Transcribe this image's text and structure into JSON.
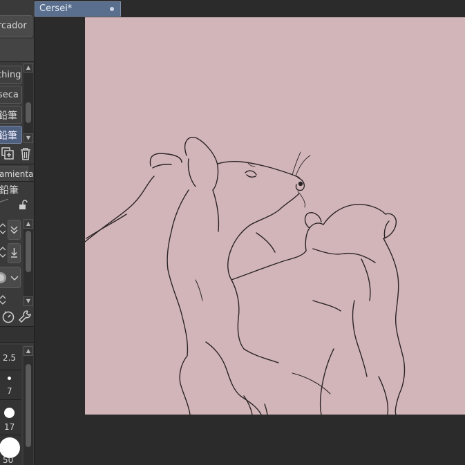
{
  "document_tab": {
    "title": "Cersei*"
  },
  "left_panel": {
    "top_button": "rcador",
    "subtool_list": [
      {
        "label": "thing",
        "selected": false
      },
      {
        "label": "seca",
        "selected": false
      },
      {
        "label": "鉛筆",
        "selected": false
      },
      {
        "label": "鉛筆",
        "selected": true
      }
    ],
    "tool_property_header": "amienta",
    "tool_name": "鉛筆",
    "brush_sizes": [
      "2.5",
      "7",
      "17",
      "50"
    ]
  },
  "colors": {
    "canvas_bg": "#d2b5b8",
    "panel_bg": "#3a3a3a",
    "workspace_bg": "#2b2b2b",
    "tab_active": "#5a6f8e",
    "selected_item": "#4f5f7e"
  },
  "icons": [
    "duplicate-icon",
    "trash-icon",
    "lock-icon",
    "chevron-updown-icon",
    "double-chevron-down-icon",
    "download-icon",
    "brush-tip-icon",
    "chevron-down-icon",
    "dial-icon",
    "wrench-icon"
  ]
}
